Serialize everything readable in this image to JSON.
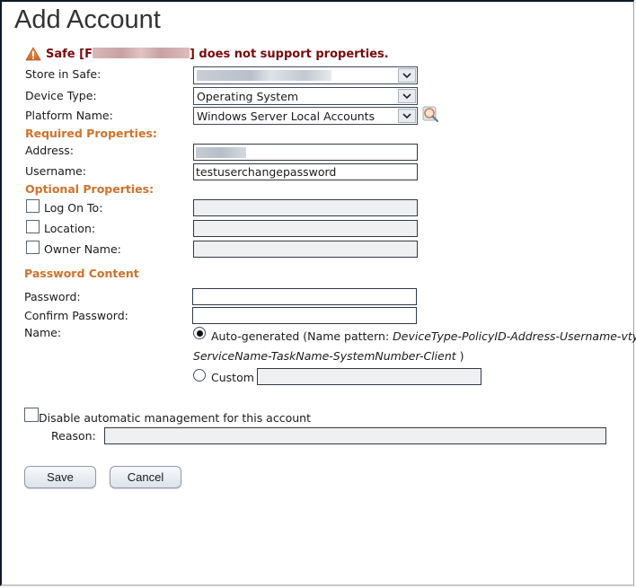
{
  "page": {
    "title": "Add Account"
  },
  "warning": {
    "icon": "warning-triangle-icon",
    "prefix": "Safe [F",
    "suffix": "] does not support properties.",
    "color": "#7a0a0a"
  },
  "fields": {
    "store_in_safe": {
      "label": "Store in Safe:",
      "value": ""
    },
    "device_type": {
      "label": "Device Type:",
      "value": "Operating System"
    },
    "platform_name": {
      "label": "Platform Name:",
      "value": "Windows Server Local Accounts",
      "search_icon": "search-magnifier-icon"
    }
  },
  "required_properties": {
    "heading": "Required Properties:",
    "address": {
      "label": "Address:",
      "value": ""
    },
    "username": {
      "label": "Username:",
      "value": "testuserchangepassword"
    }
  },
  "optional_properties": {
    "heading": "Optional Properties:",
    "items": [
      {
        "label": "Log On To:",
        "checked": false,
        "value": ""
      },
      {
        "label": "Location:",
        "checked": false,
        "value": ""
      },
      {
        "label": "Owner Name:",
        "checked": false,
        "value": ""
      }
    ]
  },
  "password_content": {
    "heading": "Password Content",
    "password": {
      "label": "Password:",
      "value": ""
    },
    "confirm_password": {
      "label": "Confirm Password:",
      "value": ""
    },
    "name": {
      "label": "Name:",
      "auto_generated": {
        "label": "Auto-generated (Name pattern: ",
        "pattern_line1": "DeviceType-PolicyID-Address-Username-vty-L",
        "pattern_line2": "ServiceName-TaskName-SystemNumber-Client",
        "closing": " )",
        "selected": true
      },
      "custom": {
        "label": "Custom",
        "selected": false,
        "value": ""
      }
    }
  },
  "disable_management": {
    "label": "Disable automatic management for this account",
    "checked": false,
    "reason_label": "Reason:",
    "reason_value": ""
  },
  "buttons": {
    "save": "Save",
    "cancel": "Cancel"
  },
  "colors": {
    "section_heading": "#d0722a",
    "warning_text": "#7a0a0a"
  }
}
